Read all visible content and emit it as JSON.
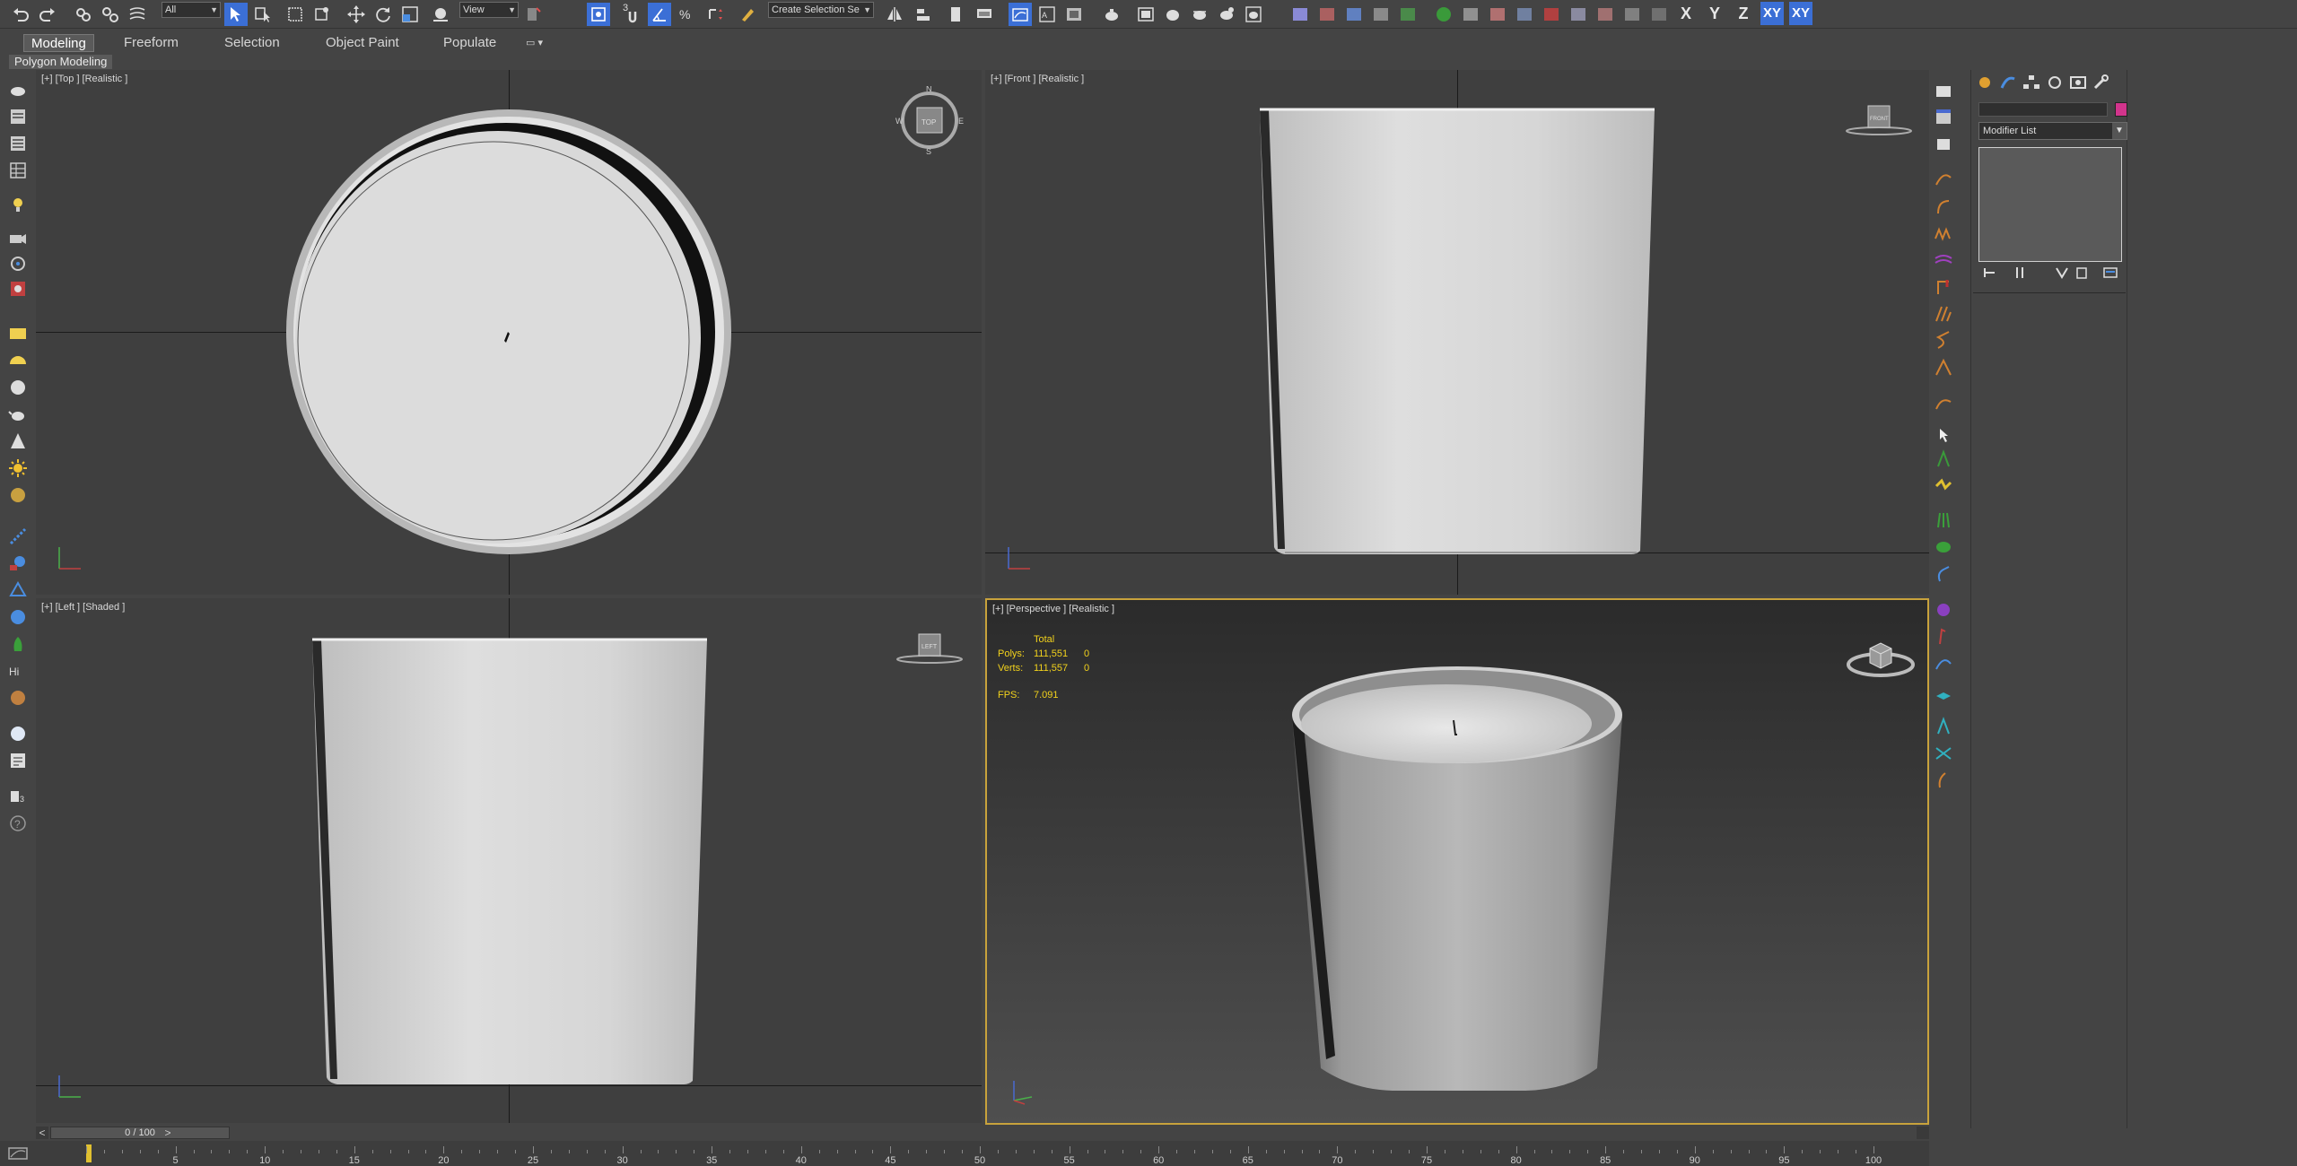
{
  "toolbar": {
    "selection_filter": "All",
    "ref_coord": "View",
    "named_selection": "Create Selection Se",
    "snaps_label": "3",
    "axis_x": "X",
    "axis_y": "Y",
    "axis_z": "Z",
    "axis_xy": "XY",
    "axis_xy2": "XY"
  },
  "ribbon": {
    "tabs": [
      "Modeling",
      "Freeform",
      "Selection",
      "Object Paint",
      "Populate"
    ],
    "active_tab": "Modeling",
    "sub_label": "Polygon Modeling"
  },
  "viewports": {
    "top": {
      "label": "[+] [Top ] [Realistic ]",
      "cube": "TOP"
    },
    "front": {
      "label": "[+] [Front ] [Realistic ]",
      "cube": "FRONT"
    },
    "left": {
      "label": "[+] [Left ] [Shaded ]",
      "cube": "LEFT"
    },
    "perspective": {
      "label": "[+] [Perspective ] [Realistic ]",
      "stats": {
        "header": "Total",
        "polys_label": "Polys:",
        "polys_total": "111,551",
        "polys_sel": "0",
        "verts_label": "Verts:",
        "verts_total": "111,557",
        "verts_sel": "0",
        "fps_label": "FPS:",
        "fps_value": "7.091"
      }
    }
  },
  "compass": {
    "n": "N",
    "s": "S",
    "e": "E",
    "w": "W"
  },
  "command_panel": {
    "modifier_list": "Modifier List"
  },
  "timeline": {
    "position": "0 / 100",
    "prev": "<",
    "next": ">",
    "ticks": [
      "5",
      "10",
      "15",
      "20",
      "25",
      "30",
      "35",
      "40",
      "45",
      "50",
      "55",
      "60",
      "65",
      "70",
      "75",
      "80",
      "85",
      "90",
      "95",
      "100"
    ]
  },
  "colors": {
    "accent": "#3b6fd6",
    "active_viewport_border": "#c8a23c",
    "stats_text": "#f2d21c",
    "object_color": "#d2348c"
  }
}
